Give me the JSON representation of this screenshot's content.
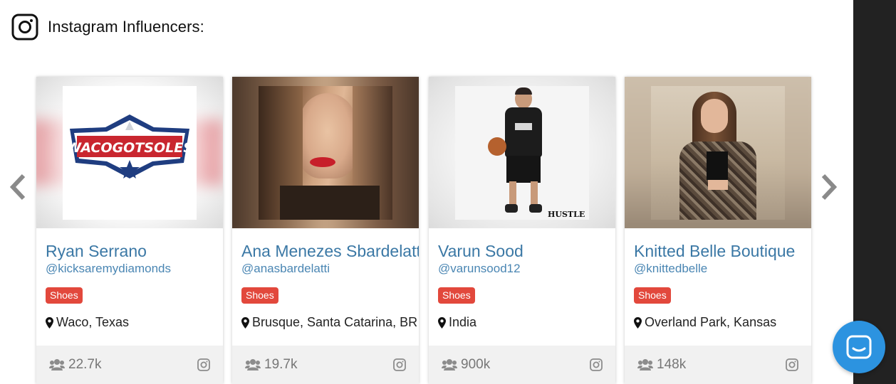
{
  "header": {
    "title": "Instagram Influencers:",
    "icon": "instagram-icon"
  },
  "carousel": {
    "prev_icon": "chevron-left-icon",
    "next_icon": "chevron-right-icon"
  },
  "cards": [
    {
      "name": "Ryan Serrano",
      "handle": "@kicksaremydiamonds",
      "tag": "Shoes",
      "location": "Waco, Texas",
      "followers": "22.7k",
      "image": "wacogotsoles-logo"
    },
    {
      "name": "Ana Menezes Sbardelatti",
      "handle": "@anasbardelatti",
      "tag": "Shoes",
      "location": "Brusque, Santa Catarina, BR",
      "followers": "19.7k",
      "image": "portrait-photo"
    },
    {
      "name": "Varun Sood",
      "handle": "@varunsood12",
      "tag": "Shoes",
      "location": "India",
      "followers": "900k",
      "image": "basketball-player-photo",
      "image_caption": "HUSTLE"
    },
    {
      "name": "Knitted Belle Boutique",
      "handle": "@knittedbelle",
      "tag": "Shoes",
      "location": "Overland Park, Kansas",
      "followers": "148k",
      "image": "fashion-photo"
    }
  ],
  "chat": {
    "icon": "chat-icon"
  },
  "colors": {
    "name": "#3b78a5",
    "tag": "#e2483c",
    "footer_bg": "#f1f1f1",
    "chat": "#2c93e0",
    "strip": "#222222"
  }
}
